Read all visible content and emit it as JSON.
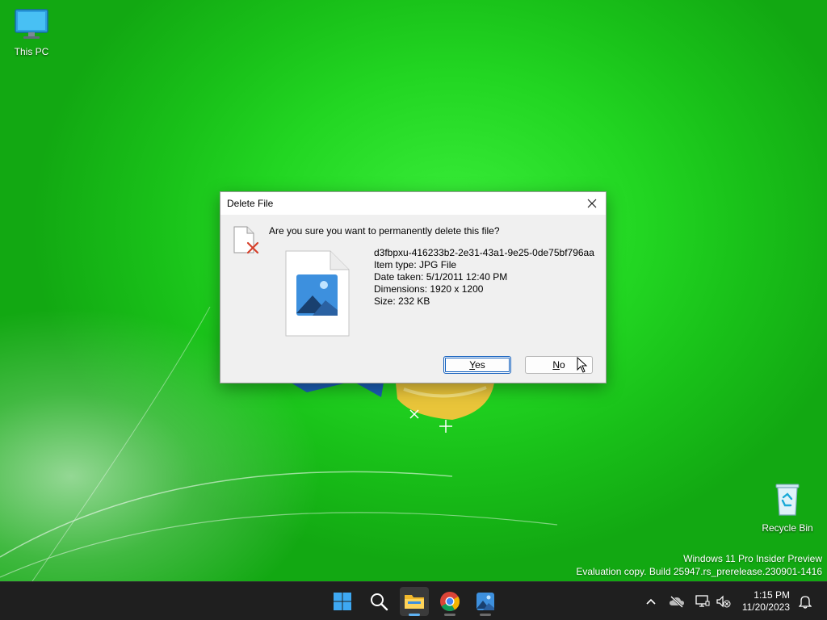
{
  "desktop": {
    "icons": [
      {
        "label": "This PC"
      },
      {
        "label": "Recycle Bin"
      }
    ],
    "watermark": {
      "line1": "Windows 11 Pro Insider Preview",
      "line2": "Evaluation copy. Build 25947.rs_prerelease.230901-1416"
    }
  },
  "dialog": {
    "title": "Delete File",
    "question": "Are you sure you want to permanently delete this file?",
    "file": {
      "name": "d3fbpxu-416233b2-2e31-43a1-9e25-0de75bf796aa",
      "item_type": "Item type: JPG File",
      "date_taken": "Date taken: 5/1/2011 12:40 PM",
      "dimensions": "Dimensions: 1920 x 1200",
      "size": "Size: 232 KB"
    },
    "buttons": {
      "yes_mnemonic": "Y",
      "yes_rest": "es",
      "no_mnemonic": "N",
      "no_rest": "o"
    }
  },
  "taskbar": {
    "apps": [
      "start-icon",
      "search-icon",
      "file-explorer-icon",
      "chrome-icon",
      "photos-icon"
    ],
    "clock": {
      "time": "1:15 PM",
      "date": "11/20/2023"
    }
  },
  "colors": {
    "desktop_green": "#22d622",
    "dialog_bg": "#f0f0f0",
    "taskbar_bg": "#1f1f1f",
    "accent_blue": "#0f5dbc"
  }
}
